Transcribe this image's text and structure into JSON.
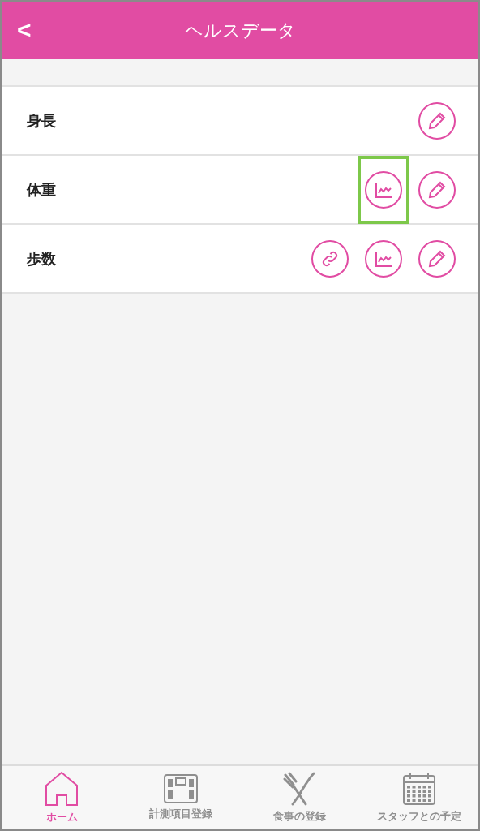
{
  "header": {
    "back": "<",
    "title": "ヘルスデータ"
  },
  "rows": [
    {
      "label": "身長",
      "actions": [
        {
          "kind": "edit",
          "highlighted": false
        }
      ]
    },
    {
      "label": "体重",
      "actions": [
        {
          "kind": "chart",
          "highlighted": true
        },
        {
          "kind": "edit",
          "highlighted": false
        }
      ]
    },
    {
      "label": "歩数",
      "actions": [
        {
          "kind": "link",
          "highlighted": false
        },
        {
          "kind": "chart",
          "highlighted": false
        },
        {
          "kind": "edit",
          "highlighted": false
        }
      ]
    }
  ],
  "tab_bar": [
    {
      "kind": "home",
      "label": "ホーム",
      "selected": true
    },
    {
      "kind": "scale",
      "label": "計測項目登録",
      "selected": false
    },
    {
      "kind": "meal",
      "label": "食事の登録",
      "selected": false
    },
    {
      "kind": "calendar",
      "label": "スタッフとの予定",
      "selected": false
    }
  ]
}
